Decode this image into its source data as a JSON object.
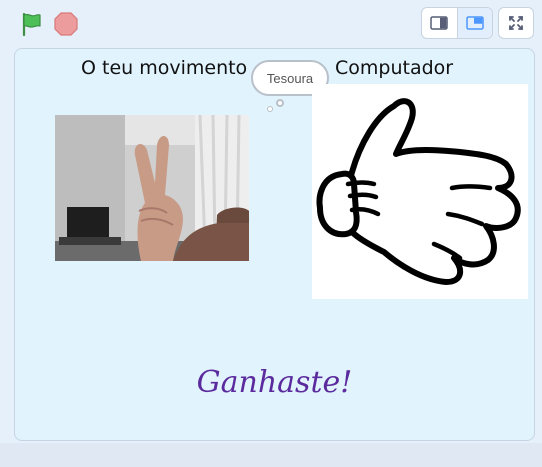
{
  "controls": {
    "green_flag": "green-flag-icon",
    "stop": "stop-icon",
    "small_stage_mode": "small-stage-icon",
    "normal_stage_mode": "normal-stage-icon",
    "fullscreen": "fullscreen-icon"
  },
  "colors": {
    "flag": "#4cbf56",
    "stop": "#ec9c9c",
    "stage_bg": "#e1f3fd",
    "result_text": "#5b2b9e",
    "accent": "#855cd6"
  },
  "stage": {
    "player_label": "O teu movimento",
    "computer_label": "Computador",
    "speech_bubble": "Tesoura",
    "result": "Ganhaste!"
  }
}
